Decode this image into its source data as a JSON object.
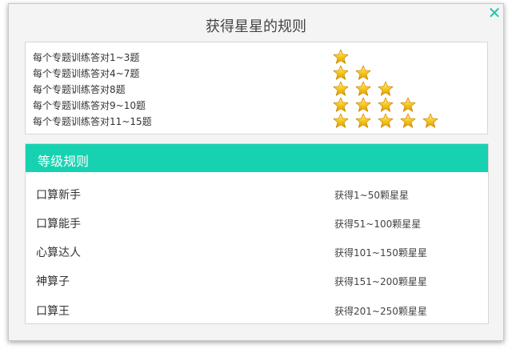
{
  "dialog": {
    "title": "获得星星的规则",
    "close_icon": "close-x-icon",
    "accent_color": "#17d2b1"
  },
  "rules": [
    {
      "label": "每个专题训练答对1~3题",
      "stars": 1
    },
    {
      "label": "每个专题训练答对4~7题",
      "stars": 2
    },
    {
      "label": "每个专题训练答对8题",
      "stars": 3
    },
    {
      "label": "每个专题训练答对9~10题",
      "stars": 4
    },
    {
      "label": "每个专题训练答对11~15题",
      "stars": 5
    }
  ],
  "levels": {
    "header": "等级规则",
    "items": [
      {
        "name": "口算新手",
        "stars": "获得1~50颗星星"
      },
      {
        "name": "口算能手",
        "stars": "获得51~100颗星星"
      },
      {
        "name": "心算达人",
        "stars": "获得101~150颗星星"
      },
      {
        "name": "神算子",
        "stars": "获得151~200颗星星"
      },
      {
        "name": "口算王",
        "stars": "获得201~250颗星星"
      }
    ]
  }
}
